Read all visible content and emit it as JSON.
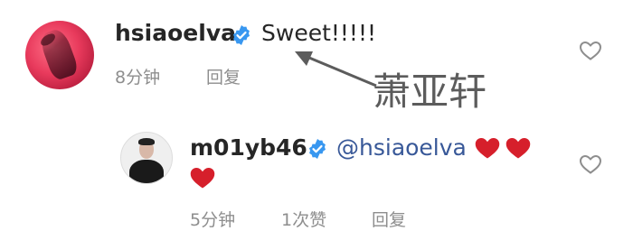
{
  "comment": {
    "username": "hsiaoelva",
    "text": "Sweet!!!!!",
    "time": "8分钟",
    "reply_label": "回复"
  },
  "annotation": {
    "label": "萧亚轩"
  },
  "reply": {
    "username": "m01yb46",
    "mention": "@hsiaoelva",
    "time": "5分钟",
    "likes_label": "1次赞",
    "reply_label": "回复"
  },
  "colors": {
    "verified_badge": "#3897f0",
    "heart_red": "#d61f2b",
    "meta_gray": "#8e8e8e",
    "arrow": "#5c5c5c"
  },
  "icons": [
    "verified-badge-icon",
    "heart-outline-icon",
    "heart-emoji-icon",
    "arrow-icon"
  ]
}
